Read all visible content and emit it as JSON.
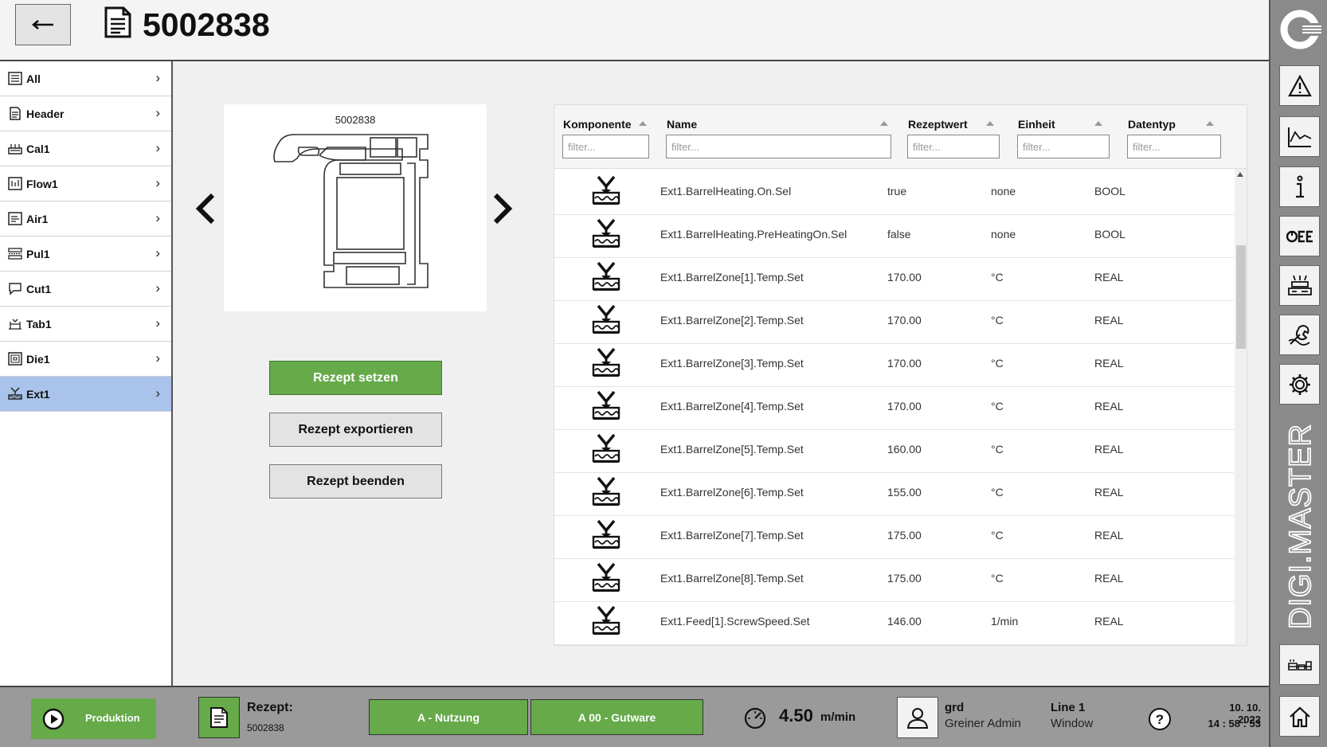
{
  "header": {
    "title": "5002838"
  },
  "nav": {
    "items": [
      {
        "label": "All",
        "icon": "list-icon",
        "active": false
      },
      {
        "label": "Header",
        "icon": "document-icon",
        "active": false
      },
      {
        "label": "Cal1",
        "icon": "calibrator-icon",
        "active": false
      },
      {
        "label": "Flow1",
        "icon": "flow-icon",
        "active": false
      },
      {
        "label": "Air1",
        "icon": "air-icon",
        "active": false
      },
      {
        "label": "Pul1",
        "icon": "puller-icon",
        "active": false
      },
      {
        "label": "Cut1",
        "icon": "cutter-icon",
        "active": false
      },
      {
        "label": "Tab1",
        "icon": "table-icon",
        "active": false
      },
      {
        "label": "Die1",
        "icon": "die-icon",
        "active": false
      },
      {
        "label": "Ext1",
        "icon": "extruder-icon",
        "active": true
      }
    ]
  },
  "profile": {
    "label": "5002838"
  },
  "actions": {
    "set": "Rezept setzen",
    "export": "Rezept exportieren",
    "end": "Rezept beenden"
  },
  "table": {
    "columns": [
      {
        "label": "Komponente",
        "placeholder": "filter..."
      },
      {
        "label": "Name",
        "placeholder": "filter..."
      },
      {
        "label": "Rezeptwert",
        "placeholder": "filter..."
      },
      {
        "label": "Einheit",
        "placeholder": "filter..."
      },
      {
        "label": "Datentyp",
        "placeholder": "filter..."
      }
    ],
    "rows": [
      {
        "name": "Ext1.BarrelHeating.On.Sel",
        "value": "true",
        "unit": "none",
        "type": "BOOL"
      },
      {
        "name": "Ext1.BarrelHeating.PreHeatingOn.Sel",
        "value": "false",
        "unit": "none",
        "type": "BOOL"
      },
      {
        "name": "Ext1.BarrelZone[1].Temp.Set",
        "value": "170.00",
        "unit": "°C",
        "type": "REAL"
      },
      {
        "name": "Ext1.BarrelZone[2].Temp.Set",
        "value": "170.00",
        "unit": "°C",
        "type": "REAL"
      },
      {
        "name": "Ext1.BarrelZone[3].Temp.Set",
        "value": "170.00",
        "unit": "°C",
        "type": "REAL"
      },
      {
        "name": "Ext1.BarrelZone[4].Temp.Set",
        "value": "170.00",
        "unit": "°C",
        "type": "REAL"
      },
      {
        "name": "Ext1.BarrelZone[5].Temp.Set",
        "value": "160.00",
        "unit": "°C",
        "type": "REAL"
      },
      {
        "name": "Ext1.BarrelZone[6].Temp.Set",
        "value": "155.00",
        "unit": "°C",
        "type": "REAL"
      },
      {
        "name": "Ext1.BarrelZone[7].Temp.Set",
        "value": "175.00",
        "unit": "°C",
        "type": "REAL"
      },
      {
        "name": "Ext1.BarrelZone[8].Temp.Set",
        "value": "175.00",
        "unit": "°C",
        "type": "REAL"
      },
      {
        "name": "Ext1.Feed[1].ScrewSpeed.Set",
        "value": "146.00",
        "unit": "1/min",
        "type": "REAL"
      }
    ]
  },
  "sidebar": {
    "buttons": [
      "alarm-icon",
      "trend-icon",
      "info-icon",
      "oee-icon",
      "machine-icon",
      "maintenance-icon",
      "settings-icon",
      "line-icon",
      "home-icon"
    ],
    "brand": "DIGI.MASTER"
  },
  "footer": {
    "production": "Produktion",
    "recipe_label": "Rezept:",
    "recipe_value": "5002838",
    "status1": "A - Nutzung",
    "status2": "A 00 - Gutware",
    "speed_value": "4.50",
    "speed_unit": "m/min",
    "user_name": "grd",
    "user_role": "Greiner Admin",
    "line_name": "Line 1",
    "line_sub": "Window",
    "date": "10. 10. 2022",
    "time": "14 : 58 : 53"
  },
  "colors": {
    "accent_green": "#66aa4a",
    "nav_active": "#a9c3ea",
    "sidebar_bg": "#8a8a8a",
    "footer_bg": "#9a9a9a"
  }
}
